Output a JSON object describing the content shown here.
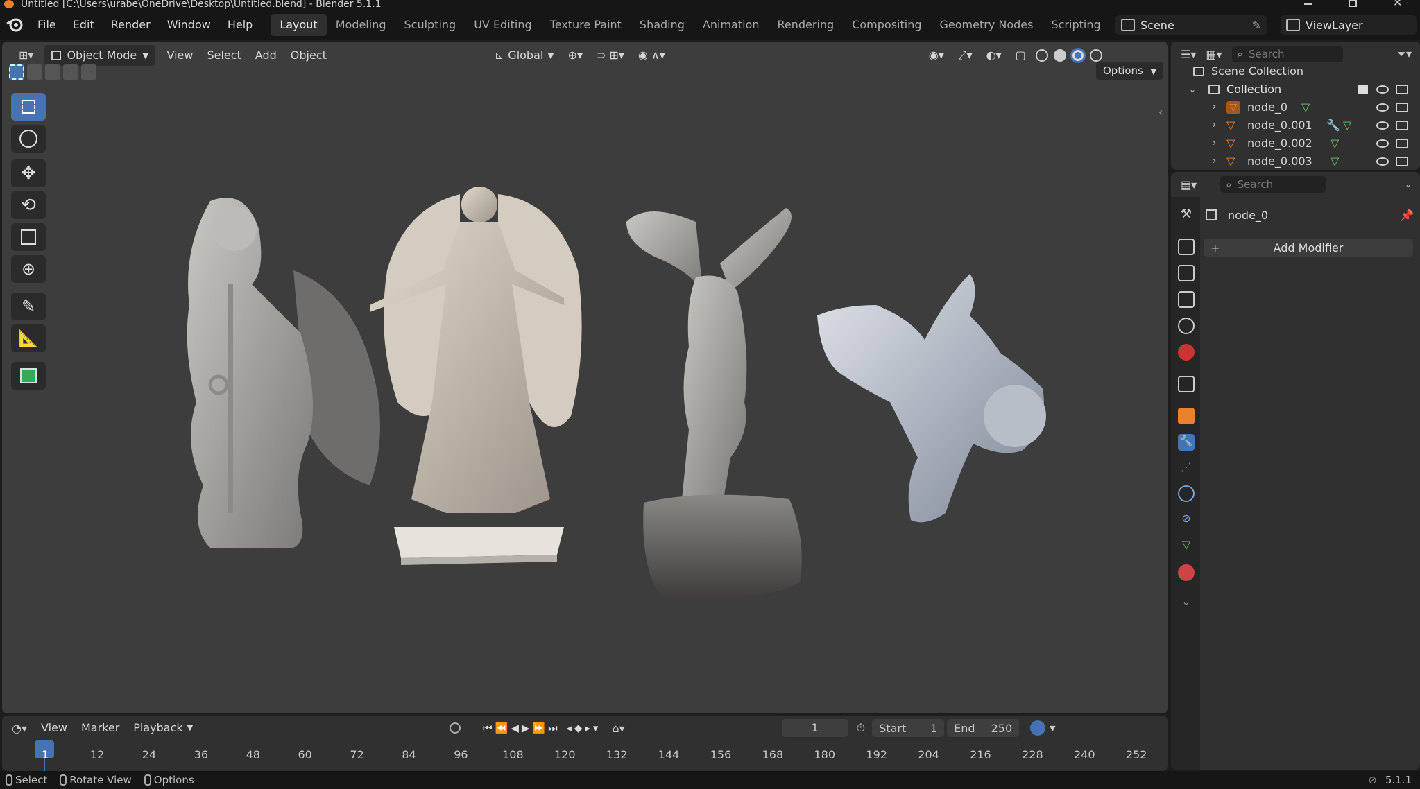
{
  "window": {
    "title": "Untitled [C:\\Users\\urabe\\OneDrive\\Desktop\\Untitled.blend] - Blender 5.1.1"
  },
  "menu": {
    "items": [
      "File",
      "Edit",
      "Render",
      "Window",
      "Help"
    ]
  },
  "workspaces": {
    "tabs": [
      "Layout",
      "Modeling",
      "Sculpting",
      "UV Editing",
      "Texture Paint",
      "Shading",
      "Animation",
      "Rendering",
      "Compositing",
      "Geometry Nodes",
      "Scripting"
    ],
    "active": "Layout",
    "add": "+"
  },
  "topright": {
    "scene": "Scene",
    "viewlayer": "ViewLayer"
  },
  "viewport": {
    "mode": "Object Mode",
    "menus": [
      "View",
      "Select",
      "Add",
      "Object"
    ],
    "orientation": "Global",
    "options": "Options"
  },
  "outliner": {
    "search_placeholder": "Search",
    "root": "Scene Collection",
    "collection": "Collection",
    "nodes": [
      "node_0",
      "node_0.001",
      "node_0.002",
      "node_0.003"
    ]
  },
  "properties": {
    "search_placeholder": "Search",
    "object_name": "node_0",
    "add_modifier": "Add Modifier"
  },
  "timeline": {
    "menus": [
      "View",
      "Marker",
      "Playback"
    ],
    "current_frame": "1",
    "start_label": "Start",
    "start": "1",
    "end_label": "End",
    "end": "250",
    "ticks": [
      "1",
      "12",
      "24",
      "36",
      "48",
      "60",
      "72",
      "84",
      "96",
      "108",
      "120",
      "132",
      "144",
      "156",
      "168",
      "180",
      "192",
      "204",
      "216",
      "228",
      "240",
      "252"
    ]
  },
  "status": {
    "select": "Select",
    "rotate": "Rotate View",
    "options": "Options",
    "version": "5.1.1"
  },
  "colors": {
    "accent": "#4772b3",
    "bg": "#3d3d3d",
    "panel": "#303030",
    "header": "#161616",
    "object_orange": "#e8812b"
  }
}
